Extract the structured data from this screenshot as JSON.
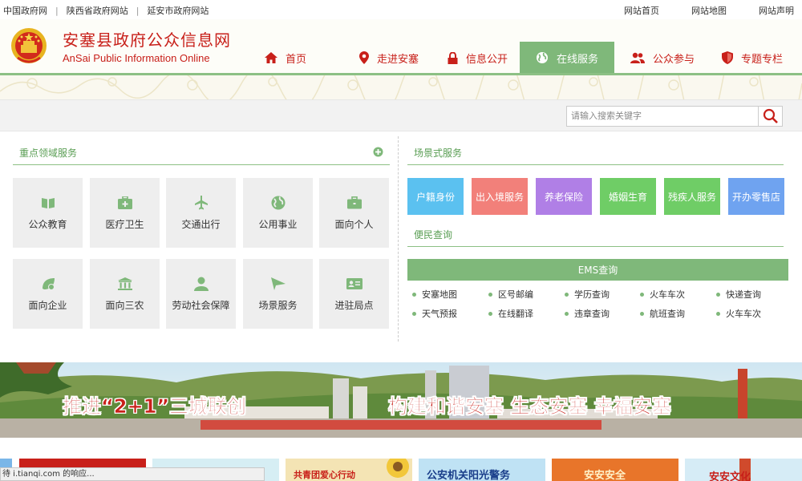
{
  "topbar": {
    "left_links": [
      "中国政府网",
      "陕西省政府网站",
      "延安市政府网站"
    ],
    "separator": "|",
    "right_links": [
      "网站首页",
      "网站地图",
      "网站声明"
    ]
  },
  "header": {
    "title": "安塞县政府公众信息网",
    "subtitle": "AnSai Public Information Online"
  },
  "nav": [
    {
      "label": "首页",
      "icon": "home-icon"
    },
    {
      "label": "走进安塞",
      "icon": "location-pin-icon"
    },
    {
      "label": "信息公开",
      "icon": "lock-icon"
    },
    {
      "label": "在线服务",
      "icon": "globe-icon",
      "active": true
    },
    {
      "label": "公众参与",
      "icon": "users-icon"
    },
    {
      "label": "专题专栏",
      "icon": "shield-icon"
    }
  ],
  "search": {
    "placeholder": "请输入搜索关键字"
  },
  "key_services": {
    "title": "重点领域服务",
    "tiles": [
      {
        "label": "公众教育",
        "icon": "book-icon"
      },
      {
        "label": "医疗卫生",
        "icon": "medkit-icon"
      },
      {
        "label": "交通出行",
        "icon": "airplane-icon"
      },
      {
        "label": "公用事业",
        "icon": "globe-icon"
      },
      {
        "label": "面向个人",
        "icon": "briefcase-icon"
      },
      {
        "label": "面向企业",
        "icon": "leaf-icon"
      },
      {
        "label": "面向三农",
        "icon": "bank-icon"
      },
      {
        "label": "劳动社会保障",
        "icon": "person-icon"
      },
      {
        "label": "场景服务",
        "icon": "send-icon"
      },
      {
        "label": "进驻局点",
        "icon": "id-card-icon"
      }
    ]
  },
  "scene_services": {
    "title": "场景式服务",
    "buttons": [
      {
        "label": "户籍身份",
        "color": "#5bc1f0"
      },
      {
        "label": "出入境服务",
        "color": "#f2807a"
      },
      {
        "label": "养老保险",
        "color": "#b07fe6"
      },
      {
        "label": "婚姻生育",
        "color": "#6fcd66"
      },
      {
        "label": "残疾人服务",
        "color": "#6fcd66"
      },
      {
        "label": "开办零售店",
        "color": "#6fa3f0"
      }
    ]
  },
  "convenience": {
    "title": "便民查询",
    "bar_label": "EMS查询",
    "links_row1": [
      "安塞地图",
      "区号邮编",
      "学历查询",
      "火车车次",
      "快递查询"
    ],
    "links_row2": [
      "天气预报",
      "在线翻译",
      "违章查询",
      "航班查询",
      "火车车次"
    ]
  },
  "banner": {
    "left_text": "推进“2+1”三城联创",
    "right_text": "构建和谐安塞 生态安塞 幸福安塞"
  },
  "thumbs": [
    {
      "text": "共青团爱心行动"
    },
    {
      "text": "公安机关阳光警务"
    },
    {
      "text": "安安安全"
    },
    {
      "text": "安安文化"
    }
  ],
  "status_text": "待 i.tianqi.com 的响应..."
}
